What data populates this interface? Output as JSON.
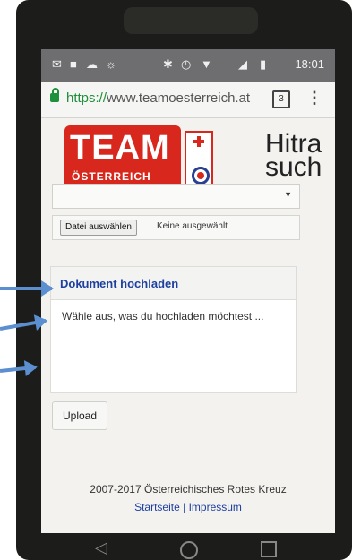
{
  "status_bar": {
    "time": "18:01",
    "icons": [
      "mail-icon",
      "image-icon",
      "cloud-icon",
      "sun-icon",
      "bluetooth-icon",
      "alarm-icon",
      "wifi-icon",
      "signal-icon",
      "battery-icon"
    ]
  },
  "browser": {
    "url_scheme": "https://",
    "url_rest": "www.teamoesterreich.at",
    "tab_count": "3"
  },
  "logo": {
    "line1": "TEAM",
    "line2": "ÖSTERREICH"
  },
  "headline": "Hitra\nsuch",
  "panel": {
    "title": "Dokument hochladen",
    "hint": "Wähle aus, was du hochladen möchtest ...",
    "select_value": "",
    "file_button": "Datei auswählen",
    "file_status": "Keine ausgewählt"
  },
  "upload_label": "Upload",
  "footer": {
    "copyright": "2007-2017 Österreichisches Rotes Kreuz",
    "link_home": "Startseite",
    "separator": "|",
    "link_imprint": "Impressum"
  },
  "colors": {
    "accent": "#5b8fd0",
    "brand_red": "#d8281d",
    "link_blue": "#1c3fa0"
  }
}
